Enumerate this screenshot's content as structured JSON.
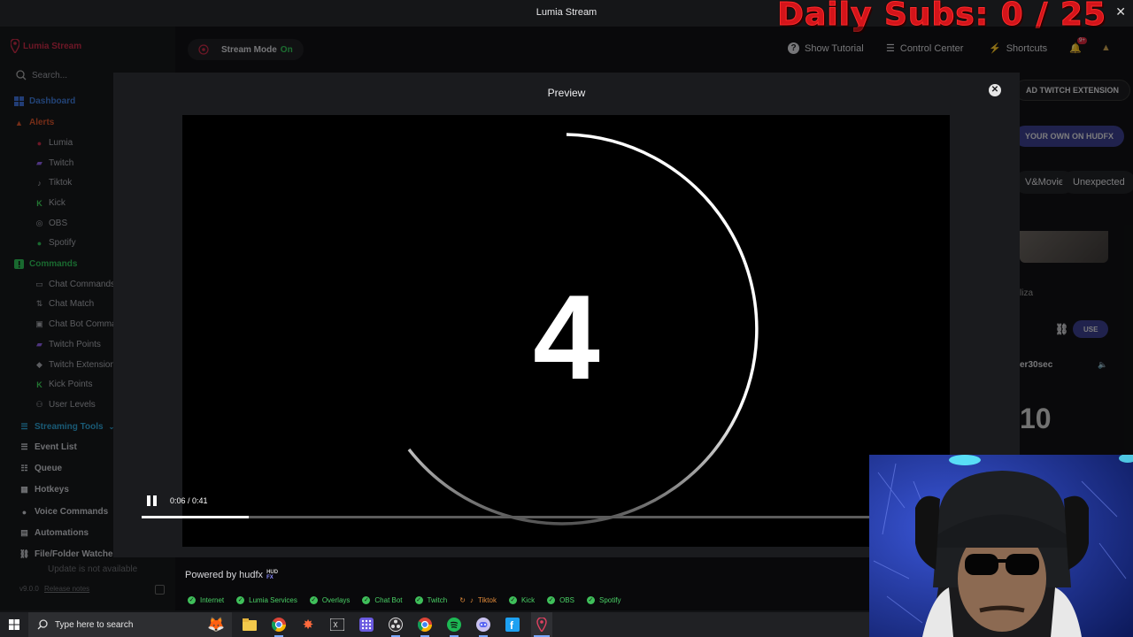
{
  "window": {
    "title": "Lumia Stream"
  },
  "overlay": {
    "daily_subs": "Daily Subs: 0 / 25"
  },
  "sidebar": {
    "logo_text": "Lumia Stream",
    "search_placeholder": "Search...",
    "items": [
      {
        "label": "Dashboard",
        "icon": "dashboard-icon",
        "color": "#3f6fd8"
      },
      {
        "label": "Alerts",
        "icon": "bell-icon",
        "color": "#d6522b"
      },
      {
        "label": "Lumia",
        "icon": "lumia-pin-icon"
      },
      {
        "label": "Twitch",
        "icon": "twitch-icon"
      },
      {
        "label": "Tiktok",
        "icon": "tiktok-icon"
      },
      {
        "label": "Kick",
        "icon": "kick-icon"
      },
      {
        "label": "OBS",
        "icon": "obs-icon"
      },
      {
        "label": "Spotify",
        "icon": "spotify-icon"
      },
      {
        "label": "Commands",
        "icon": "commands-icon",
        "color": "#2fbf57"
      },
      {
        "label": "Chat Commands",
        "icon": "chat-icon"
      },
      {
        "label": "Chat Match",
        "icon": "match-icon"
      },
      {
        "label": "Chat Bot Comma",
        "icon": "bot-icon"
      },
      {
        "label": "Twitch Points",
        "icon": "twitch-icon"
      },
      {
        "label": "Twitch Extension",
        "icon": "extension-icon"
      },
      {
        "label": "Kick Points",
        "icon": "kick-icon"
      },
      {
        "label": "User Levels",
        "icon": "users-icon"
      },
      {
        "label": "Streaming Tools",
        "icon": "tools-icon",
        "color": "#2fa4d6"
      },
      {
        "label": "Event List",
        "icon": "list-icon"
      },
      {
        "label": "Queue",
        "icon": "queue-icon"
      },
      {
        "label": "Hotkeys",
        "icon": "keyboard-icon"
      },
      {
        "label": "Voice Commands",
        "icon": "mic-icon"
      },
      {
        "label": "Automations",
        "icon": "automation-icon"
      },
      {
        "label": "File/Folder Watcher",
        "icon": "link-icon"
      }
    ],
    "update_note": "Update is not available",
    "version": "v9.0.0",
    "release_notes": "Release notes"
  },
  "topbar": {
    "stream_mode_label": "Stream Mode",
    "stream_mode_state": "On",
    "show_tutorial": "Show Tutorial",
    "control_center": "Control Center",
    "shortcuts": "Shortcuts",
    "notification_badge": "9+"
  },
  "background": {
    "add_twitch_extension": "AD TWITCH EXTENSION",
    "your_own_on_hudfx": "YOUR OWN ON HUDFX",
    "tv_movie": "V&Movie",
    "unexpected": "Unexpected",
    "card_text": "liza",
    "use_button": "USE",
    "timer_label": "er30sec",
    "timer_value": "10"
  },
  "modal": {
    "title": "Preview",
    "countdown_digit": "4",
    "time": "0:06 / 0:41",
    "progress": 0.146,
    "powered_by": "Powered by hudfx",
    "hud_logo_top": "HUD",
    "hud_logo_bottom": "FX"
  },
  "statusbar": [
    {
      "label": "Internet",
      "state": "ok"
    },
    {
      "label": "Lumia Services",
      "state": "ok"
    },
    {
      "label": "Overlays",
      "state": "ok"
    },
    {
      "label": "Chat Bot",
      "state": "ok"
    },
    {
      "label": "Twitch",
      "state": "ok"
    },
    {
      "label": "Tiktok",
      "state": "warn"
    },
    {
      "label": "Kick",
      "state": "ok"
    },
    {
      "label": "OBS",
      "state": "ok"
    },
    {
      "label": "Spotify",
      "state": "ok"
    }
  ],
  "taskbar": {
    "search_placeholder": "Type here to search",
    "apps": [
      "file-explorer-icon",
      "chrome-icon",
      "app-star-icon",
      "terminal-icon",
      "grid-app-icon",
      "obs-icon",
      "chrome-icon",
      "spotify-icon",
      "discord-icon",
      "facebook-icon",
      "lumia-pin-icon"
    ]
  },
  "colors": {
    "accent_red": "#c62a45",
    "status_green": "#3fbf5a",
    "status_orange": "#e08a3a"
  }
}
